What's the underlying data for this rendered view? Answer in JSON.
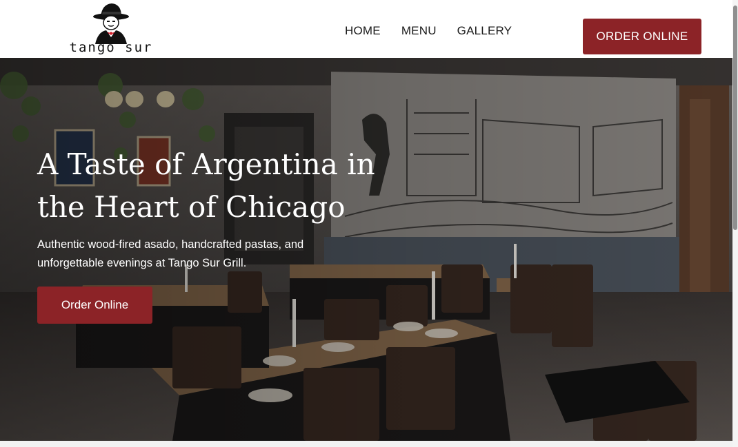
{
  "brand": {
    "name": "tango sur",
    "logo_icon": "tango-dancer-logo"
  },
  "nav": {
    "items": [
      "HOME",
      "MENU",
      "GALLERY"
    ]
  },
  "header": {
    "order_button_label": "ORDER ONLINE"
  },
  "hero": {
    "title_line1": "A Taste of Argentina in",
    "title_line2": "the Heart of Chicago",
    "subtitle": "Authentic wood-fired asado, handcrafted pastas, and unforgettable evenings at Tango Sur Grill.",
    "cta_label": "Order Online",
    "background_icon": "restaurant-interior-photo"
  },
  "colors": {
    "accent": "#8c2327",
    "header_bg": "#ffffff",
    "text_dark": "#1a1a1a"
  }
}
